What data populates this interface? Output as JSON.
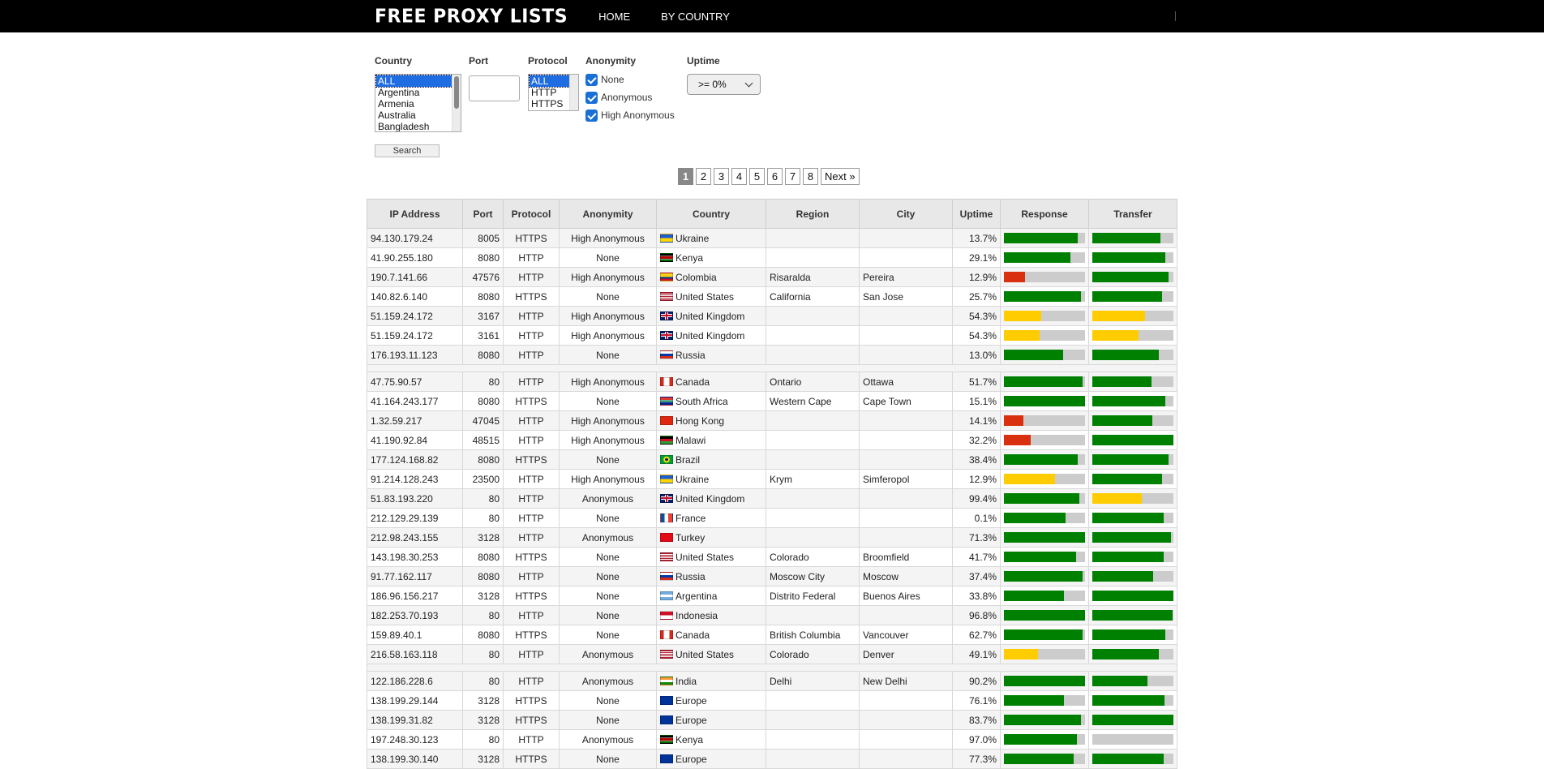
{
  "header": {
    "logo": "FREE PROXY LISTS",
    "nav": [
      "HOME",
      "BY COUNTRY"
    ]
  },
  "filters": {
    "country_label": "Country",
    "country_options": [
      "ALL",
      "Argentina",
      "Armenia",
      "Australia",
      "Bangladesh"
    ],
    "country_selected": "ALL",
    "port_label": "Port",
    "port_value": "",
    "protocol_label": "Protocol",
    "protocol_options": [
      "ALL",
      "HTTP",
      "HTTPS"
    ],
    "protocol_selected": "ALL",
    "anonymity_label": "Anonymity",
    "anonymity_options": [
      {
        "label": "None",
        "checked": true
      },
      {
        "label": "Anonymous",
        "checked": true
      },
      {
        "label": "High Anonymous",
        "checked": true
      }
    ],
    "uptime_label": "Uptime",
    "uptime_value": ">= 0%",
    "search_label": "Search"
  },
  "pagination": {
    "pages": [
      "1",
      "2",
      "3",
      "4",
      "5",
      "6",
      "7",
      "8"
    ],
    "current": "1",
    "next_label": "Next »"
  },
  "colors": {
    "good": "#008000",
    "medium": "#ffcc00",
    "bad": "#d93010",
    "empty": "#cccccc"
  },
  "table": {
    "columns": [
      "IP Address",
      "Port",
      "Protocol",
      "Anonymity",
      "Country",
      "Region",
      "City",
      "Uptime",
      "Response",
      "Transfer"
    ],
    "groups": [
      [
        {
          "ip": "94.130.179.24",
          "port": "8005",
          "protocol": "HTTPS",
          "anonymity": "High Anonymous",
          "country": "Ukraine",
          "flag": "ua",
          "region": "",
          "city": "",
          "uptime": "13.7%",
          "response": 0.91,
          "response_color": "good",
          "transfer": 0.84,
          "transfer_color": "good"
        },
        {
          "ip": "41.90.255.180",
          "port": "8080",
          "protocol": "HTTP",
          "anonymity": "None",
          "country": "Kenya",
          "flag": "ke",
          "region": "",
          "city": "",
          "uptime": "29.1%",
          "response": 0.82,
          "response_color": "good",
          "transfer": 0.9,
          "transfer_color": "good"
        },
        {
          "ip": "190.7.141.66",
          "port": "47576",
          "protocol": "HTTP",
          "anonymity": "High Anonymous",
          "country": "Colombia",
          "flag": "co",
          "region": "Risaralda",
          "city": "Pereira",
          "uptime": "12.9%",
          "response": 0.26,
          "response_color": "bad",
          "transfer": 0.94,
          "transfer_color": "good"
        },
        {
          "ip": "140.82.6.140",
          "port": "8080",
          "protocol": "HTTPS",
          "anonymity": "None",
          "country": "United States",
          "flag": "us",
          "region": "California",
          "city": "San Jose",
          "uptime": "25.7%",
          "response": 0.95,
          "response_color": "good",
          "transfer": 0.86,
          "transfer_color": "good"
        },
        {
          "ip": "51.159.24.172",
          "port": "3167",
          "protocol": "HTTP",
          "anonymity": "High Anonymous",
          "country": "United Kingdom",
          "flag": "gb",
          "region": "",
          "city": "",
          "uptime": "54.3%",
          "response": 0.46,
          "response_color": "medium",
          "transfer": 0.65,
          "transfer_color": "medium"
        },
        {
          "ip": "51.159.24.172",
          "port": "3161",
          "protocol": "HTTP",
          "anonymity": "High Anonymous",
          "country": "United Kingdom",
          "flag": "gb",
          "region": "",
          "city": "",
          "uptime": "54.3%",
          "response": 0.44,
          "response_color": "medium",
          "transfer": 0.57,
          "transfer_color": "medium"
        },
        {
          "ip": "176.193.11.123",
          "port": "8080",
          "protocol": "HTTP",
          "anonymity": "None",
          "country": "Russia",
          "flag": "ru",
          "region": "",
          "city": "",
          "uptime": "13.0%",
          "response": 0.73,
          "response_color": "good",
          "transfer": 0.82,
          "transfer_color": "good"
        }
      ],
      [
        {
          "ip": "47.75.90.57",
          "port": "80",
          "protocol": "HTTP",
          "anonymity": "High Anonymous",
          "country": "Canada",
          "flag": "ca",
          "region": "Ontario",
          "city": "Ottawa",
          "uptime": "51.7%",
          "response": 0.97,
          "response_color": "good",
          "transfer": 0.73,
          "transfer_color": "good"
        },
        {
          "ip": "41.164.243.177",
          "port": "8080",
          "protocol": "HTTPS",
          "anonymity": "None",
          "country": "South Africa",
          "flag": "za",
          "region": "Western Cape",
          "city": "Cape Town",
          "uptime": "15.1%",
          "response": 1.0,
          "response_color": "good",
          "transfer": 0.9,
          "transfer_color": "good"
        },
        {
          "ip": "1.32.59.217",
          "port": "47045",
          "protocol": "HTTP",
          "anonymity": "High Anonymous",
          "country": "Hong Kong",
          "flag": "hk",
          "region": "",
          "city": "",
          "uptime": "14.1%",
          "response": 0.24,
          "response_color": "bad",
          "transfer": 0.74,
          "transfer_color": "good"
        },
        {
          "ip": "41.190.92.84",
          "port": "48515",
          "protocol": "HTTP",
          "anonymity": "High Anonymous",
          "country": "Malawi",
          "flag": "mw",
          "region": "",
          "city": "",
          "uptime": "32.2%",
          "response": 0.33,
          "response_color": "bad",
          "transfer": 1.0,
          "transfer_color": "good"
        },
        {
          "ip": "177.124.168.82",
          "port": "8080",
          "protocol": "HTTPS",
          "anonymity": "None",
          "country": "Brazil",
          "flag": "br",
          "region": "",
          "city": "",
          "uptime": "38.4%",
          "response": 0.91,
          "response_color": "good",
          "transfer": 0.94,
          "transfer_color": "good"
        },
        {
          "ip": "91.214.128.243",
          "port": "23500",
          "protocol": "HTTP",
          "anonymity": "High Anonymous",
          "country": "Ukraine",
          "flag": "ua",
          "region": "Krym",
          "city": "Simferopol",
          "uptime": "12.9%",
          "response": 0.63,
          "response_color": "medium",
          "transfer": 0.86,
          "transfer_color": "good"
        },
        {
          "ip": "51.83.193.220",
          "port": "80",
          "protocol": "HTTP",
          "anonymity": "Anonymous",
          "country": "United Kingdom",
          "flag": "gb",
          "region": "",
          "city": "",
          "uptime": "99.4%",
          "response": 0.93,
          "response_color": "good",
          "transfer": 0.61,
          "transfer_color": "medium"
        },
        {
          "ip": "212.129.29.139",
          "port": "80",
          "protocol": "HTTP",
          "anonymity": "None",
          "country": "France",
          "flag": "fr",
          "region": "",
          "city": "",
          "uptime": "0.1%",
          "response": 0.76,
          "response_color": "good",
          "transfer": 0.88,
          "transfer_color": "good"
        },
        {
          "ip": "212.98.243.155",
          "port": "3128",
          "protocol": "HTTP",
          "anonymity": "Anonymous",
          "country": "Turkey",
          "flag": "tr",
          "region": "",
          "city": "",
          "uptime": "71.3%",
          "response": 1.0,
          "response_color": "good",
          "transfer": 0.97,
          "transfer_color": "good"
        },
        {
          "ip": "143.198.30.253",
          "port": "8080",
          "protocol": "HTTPS",
          "anonymity": "None",
          "country": "United States",
          "flag": "us",
          "region": "Colorado",
          "city": "Broomfield",
          "uptime": "41.7%",
          "response": 0.89,
          "response_color": "good",
          "transfer": 0.88,
          "transfer_color": "good"
        },
        {
          "ip": "91.77.162.117",
          "port": "8080",
          "protocol": "HTTP",
          "anonymity": "None",
          "country": "Russia",
          "flag": "ru",
          "region": "Moscow City",
          "city": "Moscow",
          "uptime": "37.4%",
          "response": 0.97,
          "response_color": "good",
          "transfer": 0.75,
          "transfer_color": "good"
        },
        {
          "ip": "186.96.156.217",
          "port": "3128",
          "protocol": "HTTPS",
          "anonymity": "None",
          "country": "Argentina",
          "flag": "ar",
          "region": "Distrito Federal",
          "city": "Buenos Aires",
          "uptime": "33.8%",
          "response": 0.74,
          "response_color": "good",
          "transfer": 1.0,
          "transfer_color": "good"
        },
        {
          "ip": "182.253.70.193",
          "port": "80",
          "protocol": "HTTP",
          "anonymity": "None",
          "country": "Indonesia",
          "flag": "id",
          "region": "",
          "city": "",
          "uptime": "96.8%",
          "response": 1.0,
          "response_color": "good",
          "transfer": 0.99,
          "transfer_color": "good"
        },
        {
          "ip": "159.89.40.1",
          "port": "8080",
          "protocol": "HTTPS",
          "anonymity": "None",
          "country": "Canada",
          "flag": "ca",
          "region": "British Columbia",
          "city": "Vancouver",
          "uptime": "62.7%",
          "response": 0.97,
          "response_color": "good",
          "transfer": 0.9,
          "transfer_color": "good"
        },
        {
          "ip": "216.58.163.118",
          "port": "80",
          "protocol": "HTTP",
          "anonymity": "Anonymous",
          "country": "United States",
          "flag": "us",
          "region": "Colorado",
          "city": "Denver",
          "uptime": "49.1%",
          "response": 0.42,
          "response_color": "medium",
          "transfer": 0.82,
          "transfer_color": "good"
        }
      ],
      [
        {
          "ip": "122.186.228.6",
          "port": "80",
          "protocol": "HTTP",
          "anonymity": "Anonymous",
          "country": "India",
          "flag": "in",
          "region": "Delhi",
          "city": "New Delhi",
          "uptime": "90.2%",
          "response": 1.0,
          "response_color": "good",
          "transfer": 0.68,
          "transfer_color": "good"
        },
        {
          "ip": "138.199.29.144",
          "port": "3128",
          "protocol": "HTTPS",
          "anonymity": "None",
          "country": "Europe",
          "flag": "eu",
          "region": "",
          "city": "",
          "uptime": "76.1%",
          "response": 0.74,
          "response_color": "good",
          "transfer": 0.89,
          "transfer_color": "good"
        },
        {
          "ip": "138.199.31.82",
          "port": "3128",
          "protocol": "HTTPS",
          "anonymity": "None",
          "country": "Europe",
          "flag": "eu",
          "region": "",
          "city": "",
          "uptime": "83.7%",
          "response": 0.95,
          "response_color": "good",
          "transfer": 1.0,
          "transfer_color": "good"
        },
        {
          "ip": "197.248.30.123",
          "port": "80",
          "protocol": "HTTP",
          "anonymity": "Anonymous",
          "country": "Kenya",
          "flag": "ke",
          "region": "",
          "city": "",
          "uptime": "97.0%",
          "response": 0.9,
          "response_color": "good",
          "transfer": 0.0,
          "transfer_color": "good"
        },
        {
          "ip": "138.199.30.140",
          "port": "3128",
          "protocol": "HTTPS",
          "anonymity": "None",
          "country": "Europe",
          "flag": "eu",
          "region": "",
          "city": "",
          "uptime": "77.3%",
          "response": 0.86,
          "response_color": "good",
          "transfer": 0.88,
          "transfer_color": "good"
        }
      ]
    ]
  }
}
